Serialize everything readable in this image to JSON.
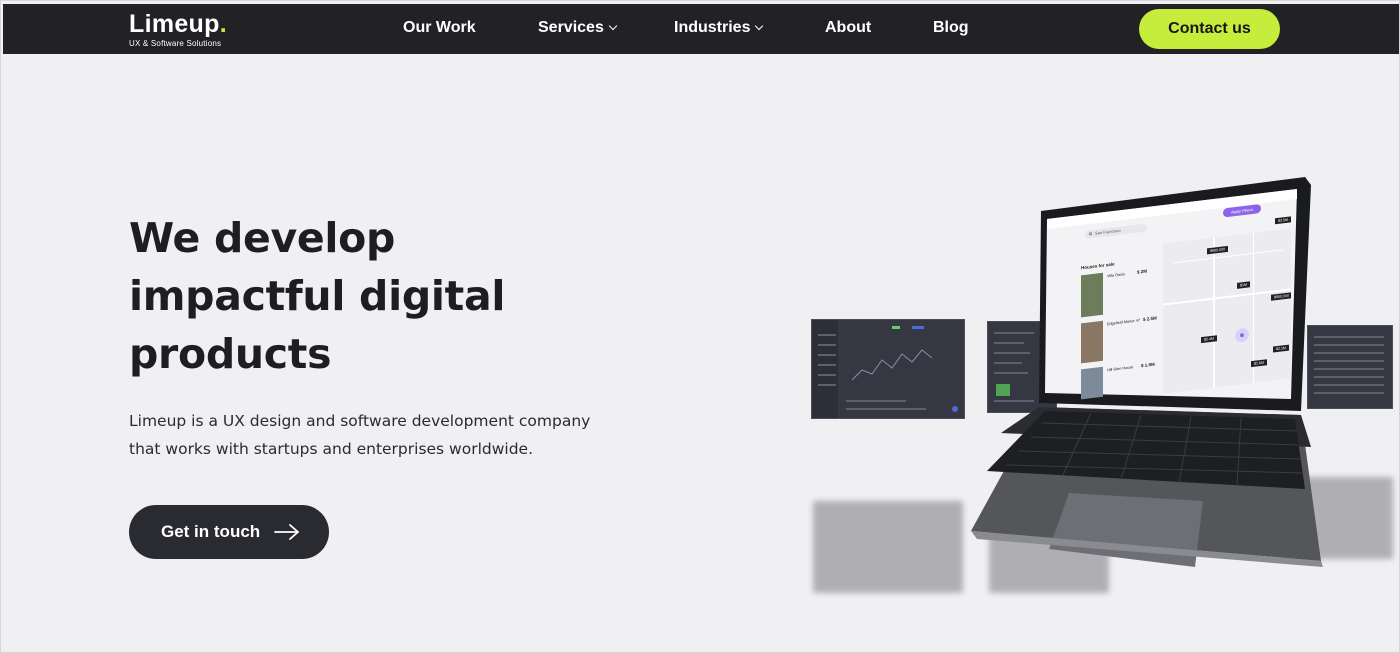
{
  "brand": {
    "name": "Limeup",
    "dot": ".",
    "tagline": "UX & Software Solutions",
    "accent_color": "#c6ec3c",
    "nav_bg": "#222226"
  },
  "nav": {
    "items": [
      {
        "label": "Our Work",
        "dropdown": false
      },
      {
        "label": "Services",
        "dropdown": true
      },
      {
        "label": "Industries",
        "dropdown": true
      },
      {
        "label": "About",
        "dropdown": false
      },
      {
        "label": "Blog",
        "dropdown": false
      }
    ],
    "cta_label": "Contact us"
  },
  "hero": {
    "headline_lines": [
      "We develop",
      "impactful digital",
      "products"
    ],
    "description_lines": [
      "Limeup is a UX design and software development company",
      "that works with startups and enterprises worldwide."
    ],
    "button_label": "Get in touch",
    "button_icon": "arrow-right-icon"
  },
  "illustration": {
    "laptop_app": {
      "search_placeholder": "San Francisco",
      "button_label": "Apply Filters",
      "section_title": "Houses for sale",
      "listings": [
        {
          "name": "Villa Oasis",
          "price": "$ 2M"
        },
        {
          "name": "Edgefield Manor 47",
          "price": "$ 2.5M"
        },
        {
          "name": "Hill Glen House",
          "price": "$ 1.9M"
        }
      ],
      "map_pins": [
        "$680,000",
        "$3.5M",
        "$1M",
        "$850,000",
        "$2.1M",
        "$1.8M",
        "$2.4M"
      ]
    }
  }
}
